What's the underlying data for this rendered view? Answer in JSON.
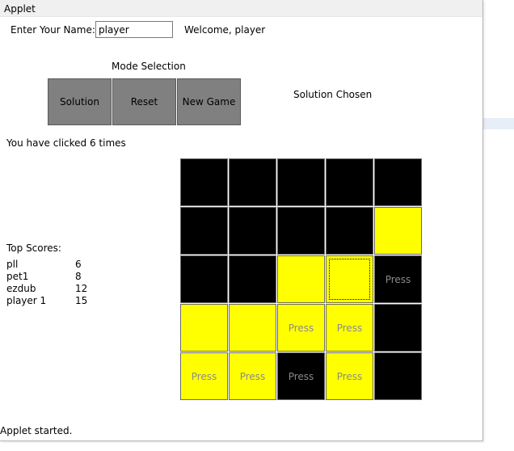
{
  "window": {
    "title": "Applet"
  },
  "name_label": "Enter Your Name:",
  "name_value": "player",
  "welcome": "Welcome, player",
  "mode_label": "Mode Selection",
  "buttons": {
    "solution": "Solution",
    "reset": "Reset",
    "new_game": "New Game"
  },
  "mode_status": "Solution Chosen",
  "clicks_text": "You have clicked 6 times",
  "scores_title": "Top Scores:",
  "scores": [
    {
      "name": "pll",
      "score": "6"
    },
    {
      "name": "pet1",
      "score": "8"
    },
    {
      "name": "ezdub",
      "score": "12"
    },
    {
      "name": "player 1",
      "score": "15"
    }
  ],
  "colors": {
    "on": "#ffff00",
    "off": "#000000"
  },
  "grid": [
    [
      {
        "on": false,
        "label": ""
      },
      {
        "on": false,
        "label": ""
      },
      {
        "on": false,
        "label": ""
      },
      {
        "on": false,
        "label": ""
      },
      {
        "on": false,
        "label": ""
      }
    ],
    [
      {
        "on": false,
        "label": ""
      },
      {
        "on": false,
        "label": ""
      },
      {
        "on": false,
        "label": ""
      },
      {
        "on": false,
        "label": ""
      },
      {
        "on": true,
        "label": ""
      }
    ],
    [
      {
        "on": false,
        "label": ""
      },
      {
        "on": false,
        "label": ""
      },
      {
        "on": true,
        "label": ""
      },
      {
        "on": true,
        "label": "",
        "focus": true
      },
      {
        "on": false,
        "label": "Press"
      }
    ],
    [
      {
        "on": true,
        "label": ""
      },
      {
        "on": true,
        "label": ""
      },
      {
        "on": true,
        "label": "Press"
      },
      {
        "on": true,
        "label": "Press"
      },
      {
        "on": false,
        "label": ""
      }
    ],
    [
      {
        "on": true,
        "label": "Press"
      },
      {
        "on": true,
        "label": "Press"
      },
      {
        "on": false,
        "label": "Press"
      },
      {
        "on": true,
        "label": "Press"
      },
      {
        "on": false,
        "label": ""
      }
    ]
  ],
  "status": "Applet started."
}
